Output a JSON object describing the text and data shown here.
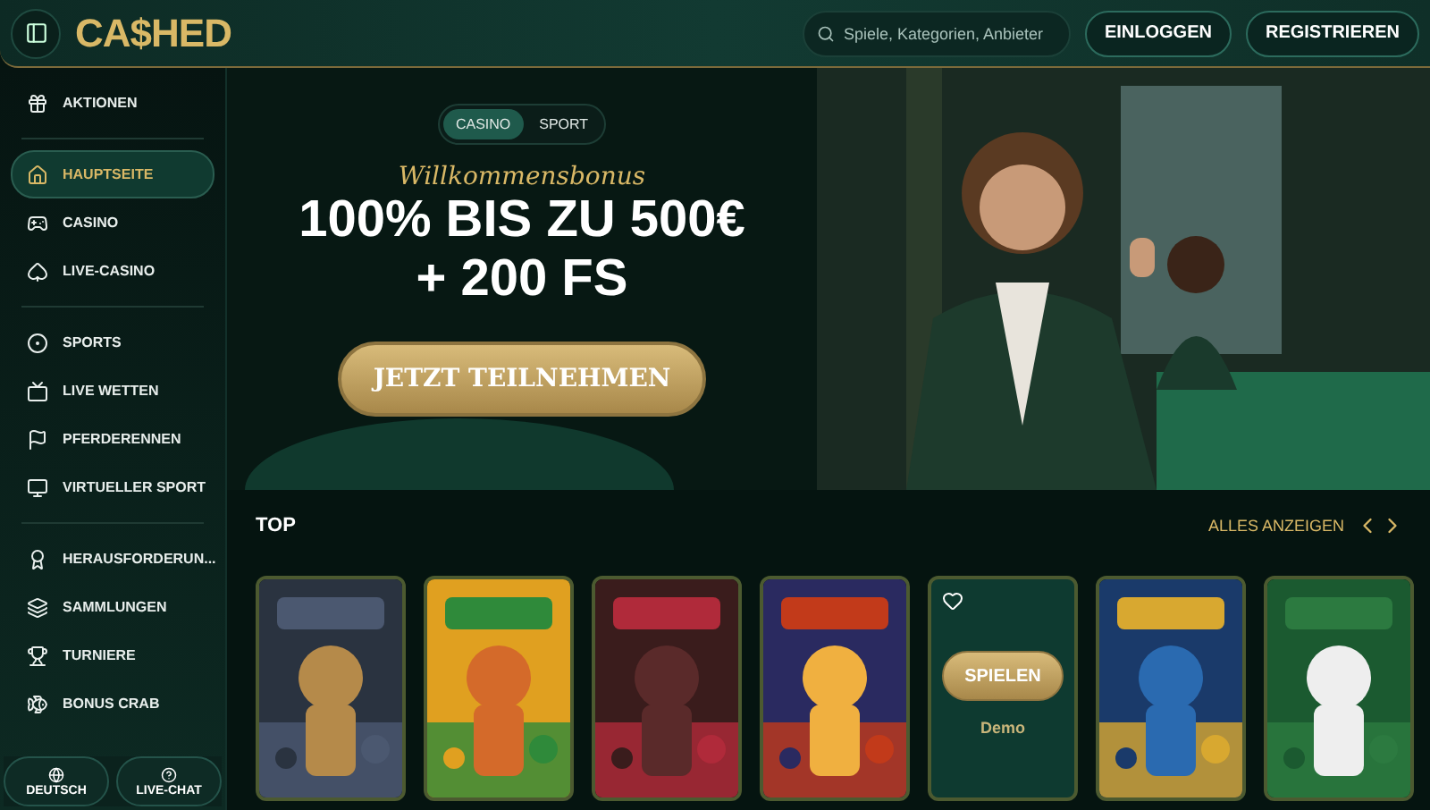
{
  "header": {
    "logo": "CA$HED",
    "search": {
      "placeholder": "Spiele, Kategorien, Anbieter"
    },
    "buttons": [
      "EINLOGGEN",
      "REGISTRIEREN"
    ]
  },
  "sidebar": {
    "groups": [
      {
        "items": [
          {
            "label": "AKTIONEN",
            "selected": false
          }
        ]
      },
      {
        "items": [
          {
            "label": "HAUPTSEITE",
            "selected": true
          },
          {
            "label": "CASINO",
            "selected": false
          },
          {
            "label": "LIVE-CASINO",
            "selected": false
          }
        ]
      },
      {
        "items": [
          {
            "label": "SPORTS",
            "selected": false
          },
          {
            "label": "LIVE WETTEN",
            "selected": false
          },
          {
            "label": "PFERDERENNEN",
            "selected": false
          },
          {
            "label": "VIRTUELLER SPORT",
            "selected": false
          }
        ]
      },
      {
        "items": [
          {
            "label": "HERAUSFORDERUN...",
            "selected": false
          },
          {
            "label": "SAMMLUNGEN",
            "selected": false
          },
          {
            "label": "TURNIERE",
            "selected": false
          },
          {
            "label": "BONUS CRAB",
            "selected": false
          }
        ]
      }
    ],
    "footer": [
      "DEUTSCH",
      "LIVE-CHAT"
    ]
  },
  "hero": {
    "tabs": [
      {
        "label": "CASINO",
        "selected": true
      },
      {
        "label": "SPORT",
        "selected": false
      }
    ],
    "subtitle": "Willkommensbonus",
    "headline": [
      "100% BIS ZU 500€",
      "+ 200 FS"
    ],
    "cta": "JETZT TEILNEHMEN"
  },
  "top": {
    "title": "TOP",
    "link": "ALLES ANZEIGEN",
    "games": [
      {
        "kind": "picture"
      },
      {
        "kind": "picture"
      },
      {
        "kind": "picture"
      },
      {
        "kind": "picture"
      },
      {
        "kind": "hover",
        "play": "SPIELEN",
        "demo": "Demo"
      },
      {
        "kind": "picture"
      },
      {
        "kind": "picture"
      }
    ]
  }
}
